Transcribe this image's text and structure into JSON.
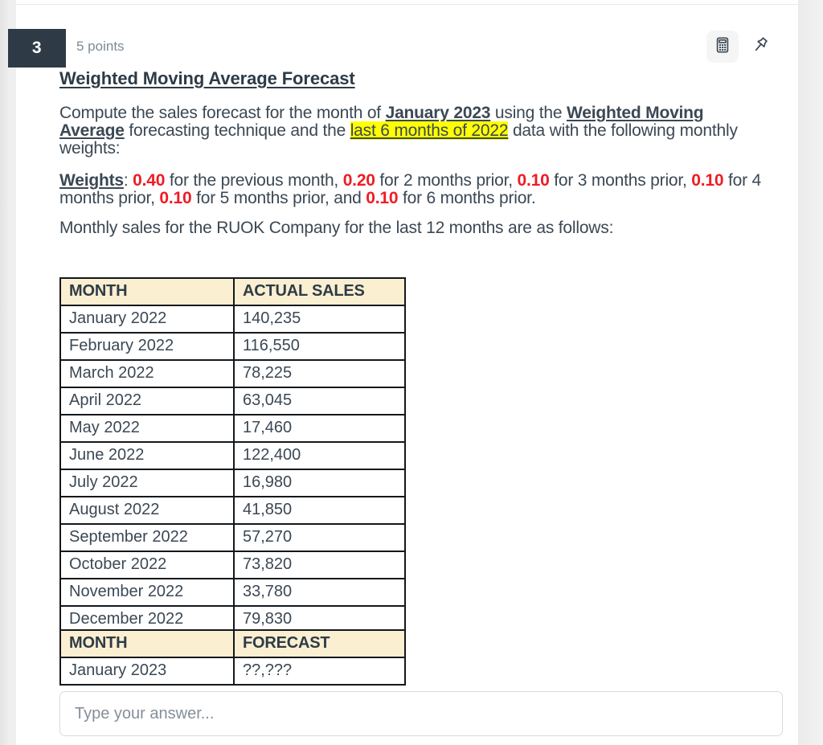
{
  "question": {
    "number": "3",
    "points_label": "5 points",
    "title": "Weighted Moving Average Forecast",
    "prompt": {
      "lead": "Compute the sales forecast for the month of ",
      "target_month": "January 2023",
      "mid1": " using the ",
      "technique": "Weighted Moving Average",
      "mid2": " forecasting technique and the ",
      "highlight": "last 6 months of 2022",
      "tail": " data with the following monthly weights:"
    },
    "weights_line": {
      "label": "Weights",
      "colon": ": ",
      "w1": "0.40",
      "t1": " for the previous month, ",
      "w2": "0.20",
      "t2": " for 2 months prior, ",
      "w3": "0.10",
      "t3": " for 3 months prior, ",
      "w4": "0.10",
      "t4": " for 4 months prior, ",
      "w5": "0.10",
      "t5": " for 5 months prior, and ",
      "w6": "0.10",
      "t6": " for 6 months prior."
    },
    "intro": "Monthly sales for the RUOK Company for the last 12 months are as follows:"
  },
  "sales_table": {
    "headers": [
      "MONTH",
      "ACTUAL SALES"
    ],
    "rows": [
      [
        "January 2022",
        "140,235"
      ],
      [
        "February 2022",
        "116,550"
      ],
      [
        "March 2022",
        "78,225"
      ],
      [
        "April 2022",
        "63,045"
      ],
      [
        "May 2022",
        "17,460"
      ],
      [
        "June 2022",
        "122,400"
      ],
      [
        "July 2022",
        "16,980"
      ],
      [
        "August 2022",
        "41,850"
      ],
      [
        "September 2022",
        "57,270"
      ],
      [
        "October 2022",
        "73,820"
      ],
      [
        "November 2022",
        "33,780"
      ],
      [
        "December 2022",
        "79,830"
      ]
    ]
  },
  "forecast_table": {
    "headers": [
      "MONTH",
      "FORECAST"
    ],
    "rows": [
      [
        "January 2023",
        "??,???"
      ]
    ]
  },
  "answer": {
    "placeholder": "Type your answer...",
    "value": ""
  },
  "icons": {
    "calculator": "calculator-icon",
    "pin": "pin-icon"
  },
  "colors": {
    "badge_bg": "#2e3b47",
    "highlight": "#ffff00",
    "weight_red": "#ee1c25",
    "table_header_bg": "#fbefd1",
    "text": "#3b4854"
  }
}
